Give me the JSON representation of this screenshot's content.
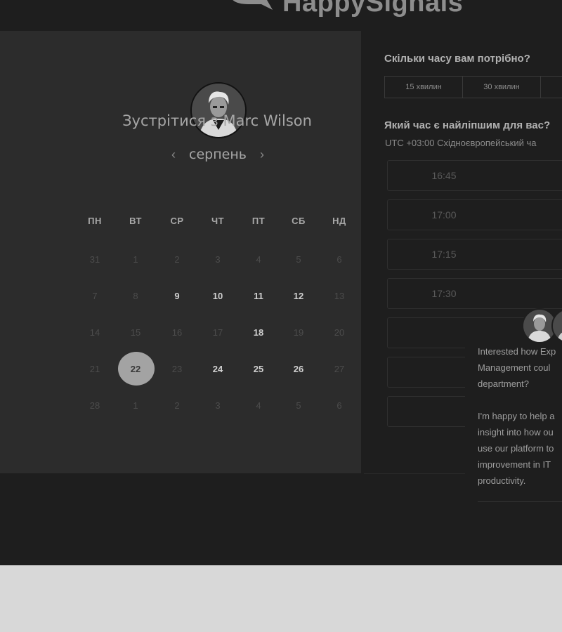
{
  "brand": {
    "name": "HappySignals"
  },
  "calendar": {
    "title": "Зустрітися з Marc Wilson",
    "month": "серпень",
    "prev_icon": "chevron-left-icon",
    "next_icon": "chevron-right-icon",
    "weekdays": [
      "ПН",
      "ВТ",
      "СР",
      "ЧТ",
      "ПТ",
      "СБ",
      "НД"
    ],
    "weeks": [
      [
        "31",
        "1",
        "2",
        "3",
        "4",
        "5",
        "6"
      ],
      [
        "7",
        "8",
        "9",
        "10",
        "11",
        "12",
        "13"
      ],
      [
        "14",
        "15",
        "16",
        "17",
        "18",
        "19",
        "20"
      ],
      [
        "21",
        "22",
        "23",
        "24",
        "25",
        "26",
        "27"
      ],
      [
        "28",
        "1",
        "2",
        "3",
        "4",
        "5",
        "6"
      ]
    ],
    "available_days": [
      "9",
      "10",
      "11",
      "12",
      "18",
      "24",
      "25",
      "26"
    ],
    "selected_day": "22"
  },
  "duration": {
    "question": "Скільки часу вам потрібно?",
    "options": [
      "15 хвилин",
      "30 хвилин"
    ]
  },
  "time": {
    "question": "Який час є найліпшим для вас?",
    "timezone": "UTC +03:00 Східноєвропейський ча",
    "slots": [
      "16:45",
      "17:00",
      "17:15",
      "17:30",
      "",
      "",
      ""
    ]
  },
  "chat": {
    "lines_p1": [
      "Interested how Exp",
      "Management coul",
      "department?"
    ],
    "lines_p2": [
      "I'm happy to help a",
      "insight into how ou",
      "use our platform to",
      "improvement in IT",
      "productivity."
    ]
  },
  "colors": {
    "page": "#1e1e1e",
    "panel": "#2c2c2c",
    "selected": "#a3a3a3",
    "outer": "#d8d8d8"
  }
}
